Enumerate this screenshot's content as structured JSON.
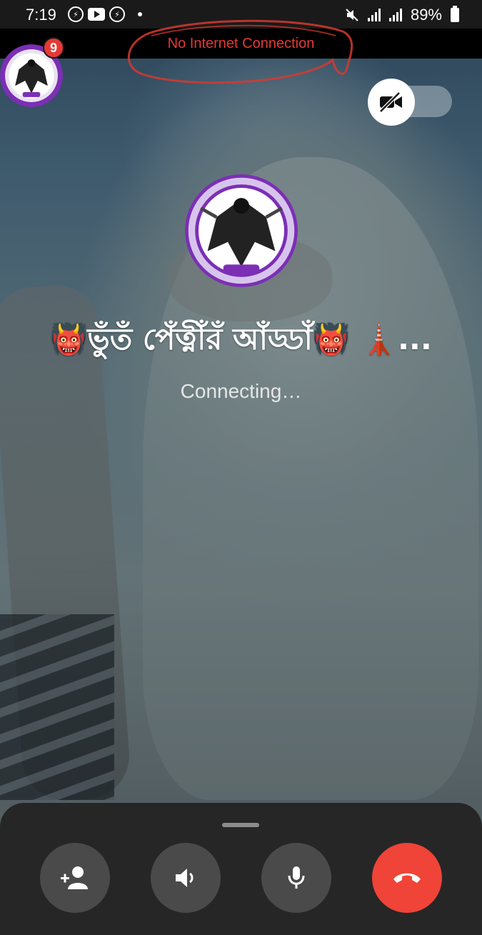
{
  "status_bar": {
    "time": "7:19",
    "battery": "89%",
    "notification_icons": [
      "messenger-icon",
      "youtube-icon",
      "messenger-icon"
    ]
  },
  "network_banner": {
    "text": "No Internet Connection",
    "color": "#e53935"
  },
  "chat_head": {
    "unread_count": "9"
  },
  "call": {
    "caller_name": "👹ভুঁতঁ পেঁত্নীঁরঁ আঁড্ডাঁ👹 🗼...",
    "status": "Connecting…",
    "video_enabled": false
  },
  "controls": [
    {
      "name": "add-person",
      "icon": "add-person-icon"
    },
    {
      "name": "speaker",
      "icon": "speaker-icon"
    },
    {
      "name": "microphone",
      "icon": "microphone-icon"
    },
    {
      "name": "end-call",
      "icon": "end-call-icon",
      "color": "#ef4437"
    }
  ]
}
